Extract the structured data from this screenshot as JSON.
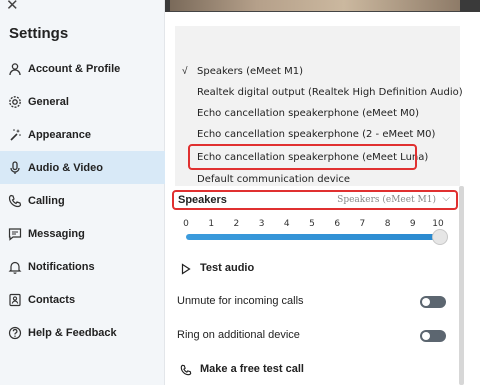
{
  "sidebar": {
    "close_icon": "close-icon",
    "title": "Settings",
    "items": [
      {
        "label": "Account & Profile",
        "icon": "person-icon",
        "active": false
      },
      {
        "label": "General",
        "icon": "gear-icon",
        "active": false
      },
      {
        "label": "Appearance",
        "icon": "magic-wand-icon",
        "active": false
      },
      {
        "label": "Audio & Video",
        "icon": "microphone-icon",
        "active": true
      },
      {
        "label": "Calling",
        "icon": "phone-icon",
        "active": false
      },
      {
        "label": "Messaging",
        "icon": "chat-icon",
        "active": false
      },
      {
        "label": "Notifications",
        "icon": "bell-icon",
        "active": false
      },
      {
        "label": "Contacts",
        "icon": "contacts-icon",
        "active": false
      },
      {
        "label": "Help & Feedback",
        "icon": "help-icon",
        "active": false
      }
    ]
  },
  "dropdown": {
    "check": "√",
    "options": [
      "Speakers (eMeet M1)",
      "Realtek digital output (Realtek High Definition Audio)",
      "Echo cancellation speakerphone (eMeet M0)",
      "Echo cancellation speakerphone (2 - eMeet M0)",
      "Echo cancellation speakerphone (eMeet Luna)",
      "Default communication device"
    ],
    "selected_index": 0,
    "highlighted_index": 4
  },
  "speakers": {
    "label": "Speakers",
    "value": "Speakers (eMeet M1)",
    "chevron_icon": "chevron-down-icon"
  },
  "volume": {
    "ticks": [
      "0",
      "1",
      "2",
      "3",
      "4",
      "5",
      "6",
      "7",
      "8",
      "9",
      "10"
    ],
    "level": 10
  },
  "test_audio": {
    "label": "Test audio",
    "icon": "play-icon"
  },
  "settings": {
    "unmute_label": "Unmute for incoming calls",
    "unmute_on": false,
    "ring_label": "Ring on additional device",
    "ring_on": false
  },
  "free_call": {
    "label": "Make a free test call",
    "icon": "phone-icon"
  },
  "colors": {
    "accent": "#2a8ad0",
    "highlight_border": "#e03030",
    "active_nav": "#d8e9f7"
  }
}
